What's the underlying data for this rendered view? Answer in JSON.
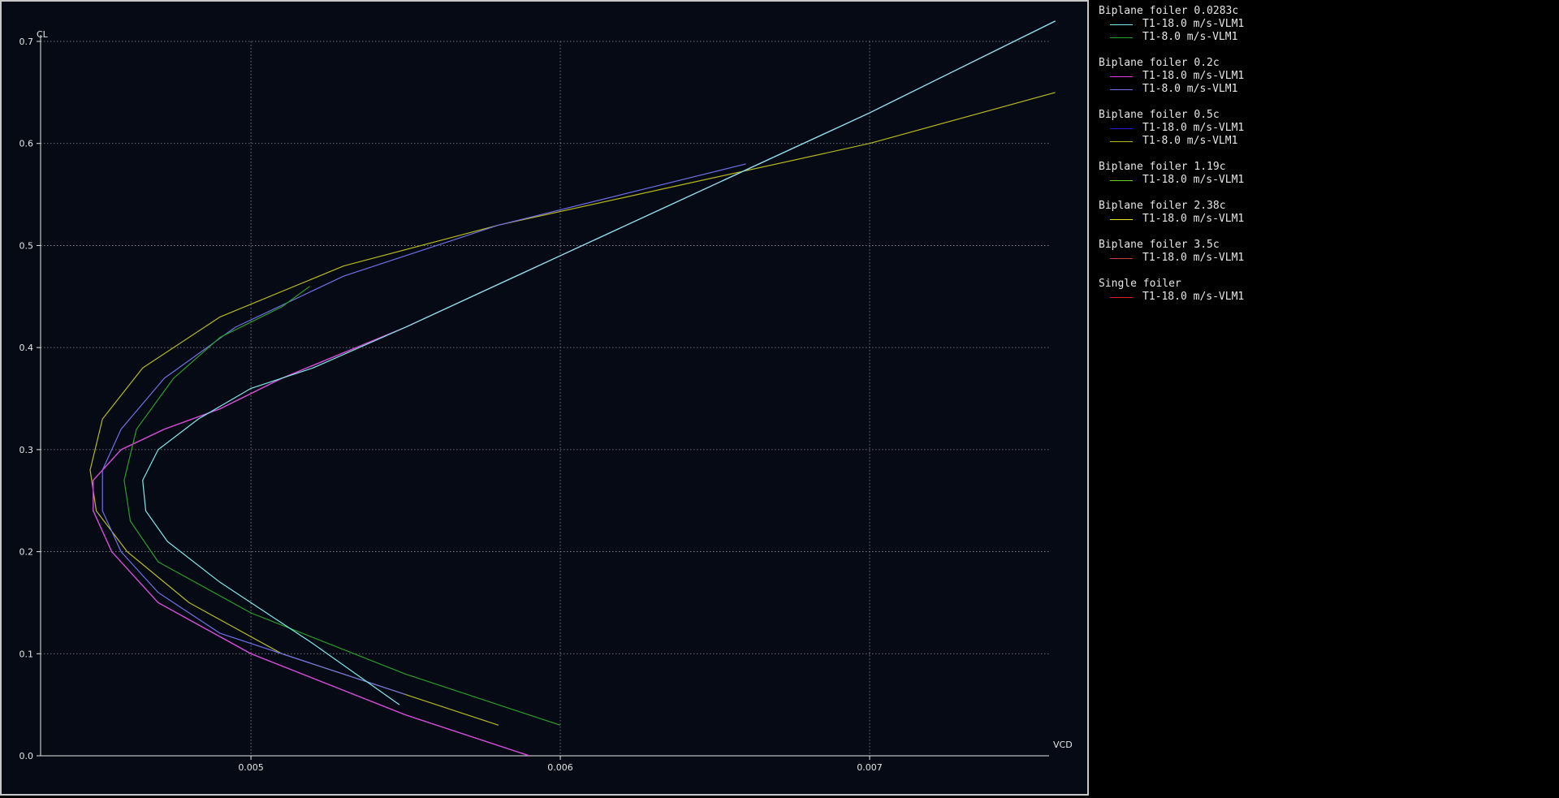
{
  "chart_data": {
    "type": "line",
    "xlabel": "VCD",
    "ylabel": "CL",
    "xlim": [
      0.00432,
      0.00758
    ],
    "ylim": [
      0.0,
      0.7
    ],
    "x_ticks": [
      "0.005",
      "0.006",
      "0.007"
    ],
    "y_ticks": [
      "0.0",
      "0.1",
      "0.2",
      "0.3",
      "0.4",
      "0.5",
      "0.6",
      "0.7"
    ],
    "grid": "dotted",
    "legend_position": "right",
    "legend_groups": [
      {
        "title": "Biplane foiler 0.0283c",
        "series": [
          {
            "name": "T1-18.0 m/s-VLM1",
            "color": "#7fe8e8",
            "x": [
              0.00548,
              0.0052,
              0.0049,
              0.00473,
              0.00466,
              0.00465,
              0.0047,
              0.00483,
              0.005,
              0.0052,
              0.0055,
              0.006,
              0.0065,
              0.007,
              0.0076
            ],
            "y": [
              0.05,
              0.11,
              0.17,
              0.21,
              0.24,
              0.27,
              0.3,
              0.33,
              0.36,
              0.38,
              0.42,
              0.49,
              0.56,
              0.63,
              0.72
            ]
          },
          {
            "name": "T1-8.0 m/s-VLM1",
            "color": "#2a9d2a",
            "x": [
              0.006,
              0.0055,
              0.005,
              0.0047,
              0.00461,
              0.00459,
              0.00463,
              0.00475,
              0.0049,
              0.0051,
              0.00519
            ],
            "y": [
              0.03,
              0.08,
              0.14,
              0.19,
              0.23,
              0.27,
              0.32,
              0.37,
              0.41,
              0.44,
              0.46
            ]
          }
        ]
      },
      {
        "title": "Biplane foiler 0.2c",
        "series": [
          {
            "name": "T1-18.0 m/s-VLM1",
            "color": "#e040e0",
            "x": [
              0.0059,
              0.0055,
              0.005,
              0.0047,
              0.00455,
              0.00449,
              0.00449,
              0.00458,
              0.00472,
              0.0049,
              0.0051,
              0.0055,
              0.006,
              0.0065,
              0.007,
              0.0076
            ],
            "y": [
              0.0,
              0.04,
              0.1,
              0.15,
              0.2,
              0.24,
              0.27,
              0.3,
              0.32,
              0.34,
              0.37,
              0.42,
              0.49,
              0.56,
              0.63,
              0.72
            ]
          },
          {
            "name": "T1-8.0 m/s-VLM1",
            "color": "#7070e8",
            "x": [
              0.0055,
              0.0052,
              0.0049,
              0.0047,
              0.00458,
              0.00452,
              0.00452,
              0.00458,
              0.00472,
              0.00495,
              0.0053,
              0.0058,
              0.0062,
              0.0066
            ],
            "y": [
              0.06,
              0.09,
              0.12,
              0.16,
              0.2,
              0.24,
              0.28,
              0.32,
              0.37,
              0.42,
              0.47,
              0.52,
              0.55,
              0.58
            ]
          }
        ]
      },
      {
        "title": "Biplane foiler 0.5c",
        "series": [
          {
            "name": "T1-18.0 m/s-VLM1",
            "color": "#2020d0",
            "x": [
              0.0059,
              0.0055,
              0.005,
              0.0047,
              0.00455,
              0.00449,
              0.00449,
              0.00458,
              0.00472,
              0.0049,
              0.0051,
              0.0055,
              0.006,
              0.0065,
              0.007,
              0.0076
            ],
            "y": [
              0.0,
              0.04,
              0.1,
              0.15,
              0.2,
              0.24,
              0.27,
              0.3,
              0.32,
              0.34,
              0.37,
              0.42,
              0.49,
              0.56,
              0.63,
              0.72
            ]
          },
          {
            "name": "T1-8.0 m/s-VLM1",
            "color": "#b8b81e",
            "x": [
              0.0058,
              0.0055,
              0.0051,
              0.0048,
              0.0046,
              0.0045,
              0.00448,
              0.00452,
              0.00465,
              0.0049,
              0.0053,
              0.0058,
              0.0064,
              0.007,
              0.0076
            ],
            "y": [
              0.03,
              0.06,
              0.1,
              0.15,
              0.2,
              0.24,
              0.28,
              0.33,
              0.38,
              0.43,
              0.48,
              0.52,
              0.56,
              0.6,
              0.65
            ]
          }
        ]
      },
      {
        "title": "Biplane foiler 1.19c",
        "series": [
          {
            "name": "T1-18.0 m/s-VLM1",
            "color": "#6cd02c",
            "x": [
              0.0059,
              0.0055,
              0.005,
              0.0047,
              0.00455,
              0.00449,
              0.00449,
              0.00458,
              0.00472,
              0.0049,
              0.0051,
              0.0055,
              0.006,
              0.0065,
              0.007,
              0.0076
            ],
            "y": [
              0.0,
              0.04,
              0.1,
              0.15,
              0.2,
              0.24,
              0.27,
              0.3,
              0.32,
              0.34,
              0.37,
              0.42,
              0.49,
              0.56,
              0.63,
              0.72
            ]
          }
        ]
      },
      {
        "title": "Biplane foiler 2.38c",
        "series": [
          {
            "name": "T1-18.0 m/s-VLM1",
            "color": "#e8e820",
            "x": [
              0.0059,
              0.0055,
              0.005,
              0.0047,
              0.00455,
              0.00449,
              0.00449,
              0.00458,
              0.00472,
              0.0049,
              0.0051,
              0.0055,
              0.006,
              0.0065,
              0.007,
              0.0076
            ],
            "y": [
              0.0,
              0.04,
              0.1,
              0.15,
              0.2,
              0.24,
              0.27,
              0.3,
              0.32,
              0.34,
              0.37,
              0.42,
              0.49,
              0.56,
              0.63,
              0.72
            ]
          }
        ]
      },
      {
        "title": "Biplane foiler 3.5c",
        "series": [
          {
            "name": "T1-18.0 m/s-VLM1",
            "color": "#c04040",
            "x": [
              0.0059,
              0.0055,
              0.005,
              0.0047,
              0.00455,
              0.00449,
              0.00449,
              0.00458,
              0.00472,
              0.0049,
              0.0051,
              0.0055,
              0.006,
              0.0065,
              0.007,
              0.0076
            ],
            "y": [
              0.0,
              0.04,
              0.1,
              0.15,
              0.2,
              0.24,
              0.27,
              0.3,
              0.32,
              0.34,
              0.37,
              0.42,
              0.49,
              0.56,
              0.63,
              0.72
            ]
          }
        ]
      },
      {
        "title": "Single foiler",
        "series": [
          {
            "name": "T1-18.0 m/s-VLM1",
            "color": "#e02020",
            "x": [
              0.0059,
              0.0055,
              0.005,
              0.0047,
              0.00455,
              0.00449,
              0.00449,
              0.00458,
              0.00472,
              0.0049,
              0.0051,
              0.0055,
              0.006,
              0.0065,
              0.007,
              0.0076
            ],
            "y": [
              0.0,
              0.04,
              0.1,
              0.15,
              0.2,
              0.24,
              0.27,
              0.3,
              0.32,
              0.34,
              0.37,
              0.42,
              0.49,
              0.56,
              0.63,
              0.72
            ]
          }
        ]
      }
    ]
  }
}
